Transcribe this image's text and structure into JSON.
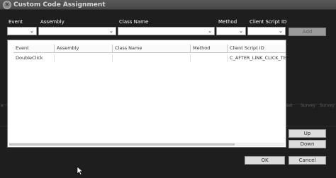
{
  "window": {
    "title": "Custom Code Assignment",
    "close_icon": "close-icon"
  },
  "filters": {
    "event_label": "Event",
    "assembly_label": "Assembly",
    "class_name_label": "Class Name",
    "method_label": "Method",
    "client_script_id_label": "Client Script ID",
    "event_value": "",
    "assembly_value": "",
    "class_name_value": "",
    "method_value": "",
    "client_script_id_value": "",
    "add_button": "Add"
  },
  "table": {
    "columns": [
      "Event",
      "Assembly",
      "Class Name",
      "Method",
      "Client Script ID"
    ],
    "rows": [
      [
        "DoubleClick",
        "",
        "",
        "",
        "C_AFTER_LINK_CLICK_TEST_"
      ]
    ]
  },
  "side_buttons": {
    "up": "Up",
    "down": "Down"
  },
  "footer": {
    "ok": "OK",
    "cancel": "Cancel"
  },
  "background": {
    "text_left": "a",
    "text_right_1": "Inset",
    "text_right_2": "Survey",
    "text_right_3": "Survey"
  },
  "colors": {
    "dialog_bg": "#1e1e1e",
    "titlebar": "#4f4f4f",
    "button_bg": "#dcdcdc",
    "disabled_button_bg": "#9a9a9a"
  }
}
